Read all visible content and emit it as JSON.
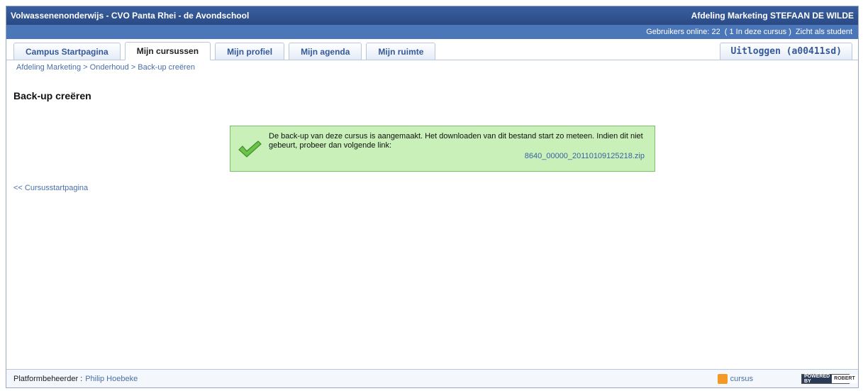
{
  "topbar": {
    "left_title": "Volwassenenonderwijs - CVO Panta Rhei - de Avondschool",
    "right_title": "Afdeling Marketing STEFAAN DE WILDE"
  },
  "subbar": {
    "users_label": "Gebruikers online: 22",
    "course_users": "( 1 In deze cursus )",
    "view_as": "Zicht als student"
  },
  "tabs": [
    {
      "label": "Campus Startpagina"
    },
    {
      "label": "Mijn cursussen"
    },
    {
      "label": "Mijn profiel"
    },
    {
      "label": "Mijn agenda"
    },
    {
      "label": "Mijn ruimte"
    }
  ],
  "logout_label": "Uitloggen (a00411sd)",
  "breadcrumb": {
    "item1": "Afdeling Marketing",
    "sep": " > ",
    "item2": "Onderhoud",
    "item3": "Back-up creëren"
  },
  "page_title": "Back-up creëren",
  "confirmation": {
    "message": "De back-up van deze cursus is aangemaakt. Het downloaden van dit bestand start zo meteen. Indien dit niet gebeurt, probeer dan volgende link:",
    "file_link": "8640_00000_20110109125218.zip"
  },
  "back_link": "<< Cursusstartpagina",
  "footer": {
    "admin_label": "Platformbeheerder :",
    "admin_name": "Philip Hoebeke",
    "rss_label": "cursus",
    "powered_1": "POWERED BY",
    "powered_2": "ROBERT"
  }
}
